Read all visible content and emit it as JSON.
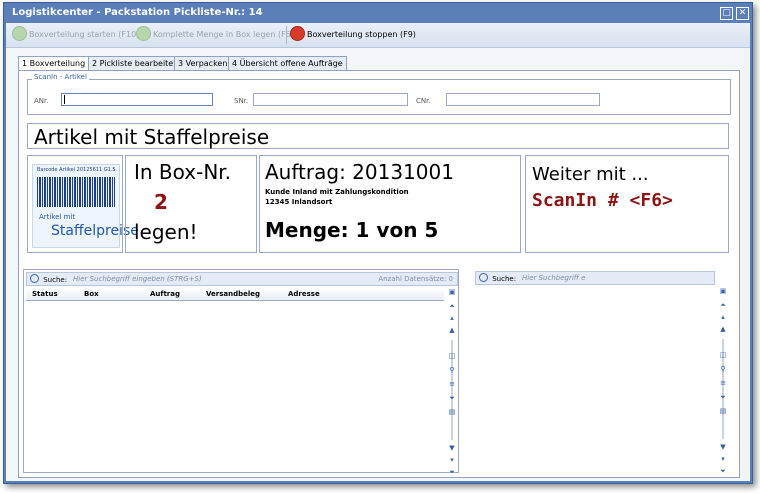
{
  "window": {
    "title": "Logistikcenter - Packstation Pickliste-Nr.: 14",
    "restore_glyph": "▢",
    "close_glyph": "✕"
  },
  "toolbar": {
    "start": {
      "label": "Boxverteilung starten (F10)",
      "icon": "green-circle-icon"
    },
    "komplett": {
      "label": "Komplette Menge in Box legen (F6)",
      "icon": "green-arrow-icon"
    },
    "stop": {
      "label": "Boxverteilung stoppen (F9)",
      "icon": "stop-icon"
    }
  },
  "tabs": [
    {
      "label": "1 Boxverteilung"
    },
    {
      "label": "2 Pickliste bearbeiten"
    },
    {
      "label": "3 Verpacken"
    },
    {
      "label": "4 Übersicht offene Aufträge"
    }
  ],
  "scanin": {
    "legend": "ScanIn - Artikel",
    "anr_label": "ANr.",
    "snr_label": "SNr.",
    "cnr_label": "CNr.",
    "anr_value": "",
    "snr_value": "",
    "cnr_value": ""
  },
  "artikel": {
    "title": "Artikel mit Staffelpreise"
  },
  "barcode_image": {
    "text": "Barcode Artikel 20125611 G1.5",
    "line1": "Artikel mit",
    "line2": "Staffelpreise"
  },
  "box": {
    "line1": "In Box-Nr.",
    "number": "2",
    "line3": "legen!"
  },
  "auftrag": {
    "title": "Auftrag: 20131001",
    "customer": "Kunde Inland mit Zahlungskondition",
    "address": "12345 Inlandsort",
    "menge": "Menge: 1 von 5"
  },
  "weiter": {
    "line1": "Weiter mit ...",
    "line2": "ScanIn # <F6>"
  },
  "left_grid": {
    "search_label": "Suche:",
    "search_placeholder": "Hier Suchbegriff eingeben (STRG+S)",
    "count_label": "Anzahl Datensätze: 0",
    "columns": [
      "Status",
      "Box",
      "Auftrag",
      "Versandbeleg",
      "Adresse"
    ]
  },
  "right_grid": {
    "search_label": "Suche:",
    "search_placeholder": "Hier Suchbegriff e"
  },
  "colors": {
    "title_blue": "#5b7fb8",
    "accent_red": "#8b1414",
    "link_blue": "#3a5fa8"
  }
}
